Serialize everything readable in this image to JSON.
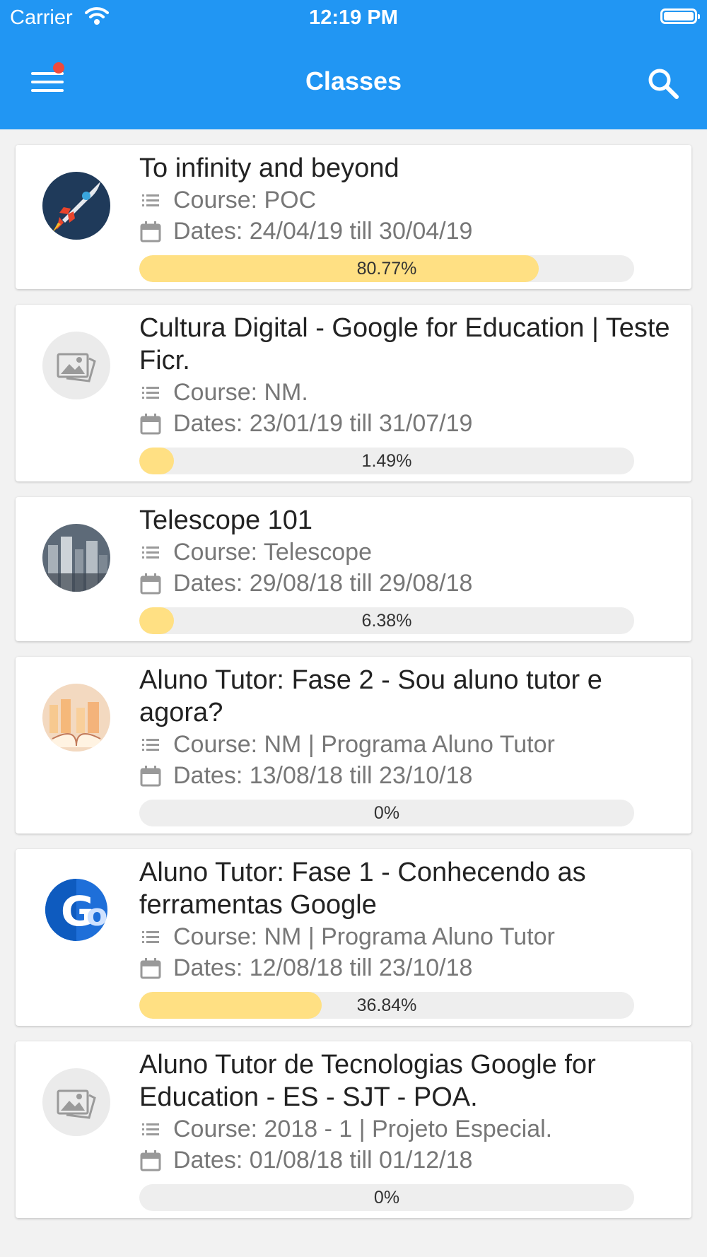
{
  "status_bar": {
    "carrier": "Carrier",
    "time": "12:19 PM"
  },
  "header": {
    "title": "Classes",
    "menu_icon": "hamburger-menu-icon",
    "search_icon": "search-icon"
  },
  "colors": {
    "primary": "#2196f3",
    "progress_fill": "#ffe083",
    "progress_track": "#eeeeee",
    "notification": "#ef4a3c"
  },
  "classes": [
    {
      "title": "To infinity and beyond",
      "course": "Course: POC",
      "dates": "Dates: 24/04/19 till 30/04/19",
      "progress_label": "80.77%",
      "progress": 80.77,
      "avatar": "rocket"
    },
    {
      "title": "Cultura Digital - Google for Education | Teste Ficr.",
      "course": "Course: NM.",
      "dates": "Dates: 23/01/19 till 31/07/19",
      "progress_label": "1.49%",
      "progress": 1.49,
      "avatar": "placeholder"
    },
    {
      "title": "Telescope 101",
      "course": "Course: Telescope",
      "dates": "Dates: 29/08/18 till 29/08/18",
      "progress_label": "6.38%",
      "progress": 6.38,
      "avatar": "city"
    },
    {
      "title": "Aluno Tutor: Fase 2 - Sou aluno tutor e agora?",
      "course": "Course: NM | Programa Aluno Tutor",
      "dates": "Dates: 13/08/18 till 23/10/18",
      "progress_label": "0%",
      "progress": 0,
      "avatar": "book"
    },
    {
      "title": "Aluno Tutor: Fase 1 - Conhecendo as ferramentas Google",
      "course": "Course: NM | Programa Aluno Tutor",
      "dates": "Dates: 12/08/18 till 23/10/18",
      "progress_label": "36.84%",
      "progress": 36.84,
      "avatar": "google-g"
    },
    {
      "title": "Aluno Tutor de Tecnologias Google for Education - ES - SJT - POA.",
      "course": "Course: 2018 - 1 | Projeto Especial.",
      "dates": "Dates: 01/08/18 till 01/12/18",
      "progress_label": "0%",
      "progress": 0,
      "avatar": "placeholder"
    }
  ]
}
